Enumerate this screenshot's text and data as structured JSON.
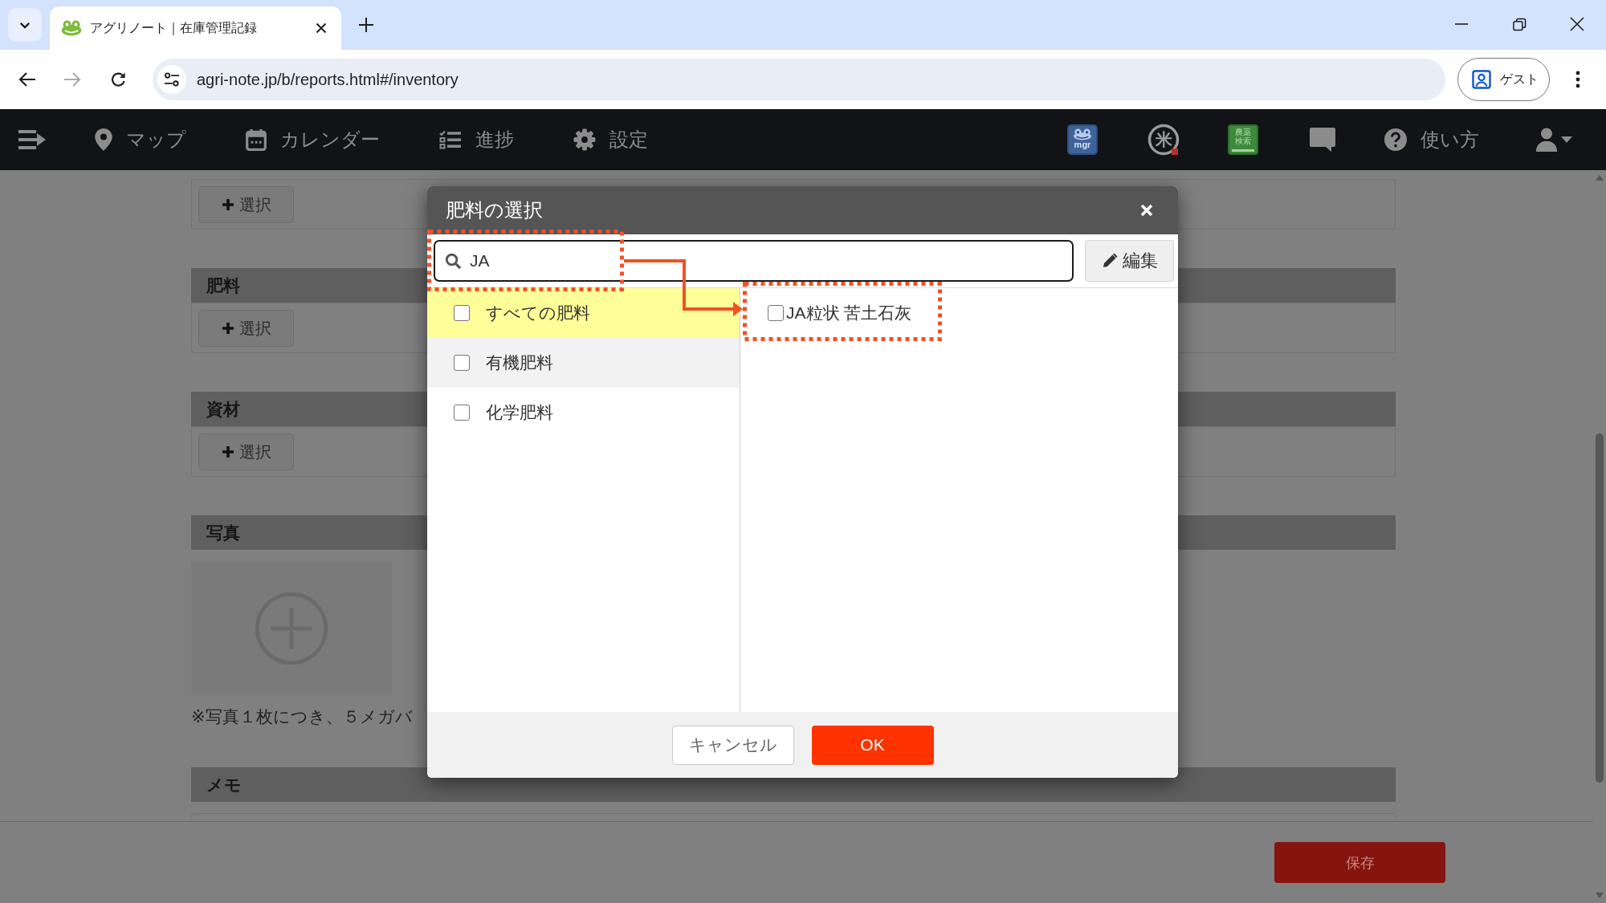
{
  "browser": {
    "tab_title": "アグリノート｜在庫管理記録",
    "forward_disabled": true,
    "url": "agri-note.jp/b/reports.html#/inventory",
    "profile_label": "ゲスト"
  },
  "navbar": {
    "links": [
      {
        "label": "マップ"
      },
      {
        "label": "カレンダー"
      },
      {
        "label": "進捗"
      },
      {
        "label": "設定"
      }
    ],
    "app_badge": "mgr",
    "rice_mark": "米",
    "book_label": "農薬検索",
    "help": "使い方"
  },
  "page": {
    "sections": [
      {
        "kind": "select",
        "button": "選択"
      },
      {
        "kind": "select",
        "title": "肥料",
        "button": "選択"
      },
      {
        "kind": "select",
        "title": "資材",
        "button": "選択"
      },
      {
        "kind": "photo",
        "title": "写真",
        "note": "※写真１枚につき、５メガバ"
      },
      {
        "kind": "memo",
        "title": "メモ"
      }
    ]
  },
  "footer": {
    "save": "保存"
  },
  "modal": {
    "title": "肥料の選択",
    "search": {
      "value": "JA"
    },
    "edit": "編集",
    "categories": [
      {
        "label": "すべての肥料",
        "checked": false,
        "selected": true
      },
      {
        "label": "有機肥料",
        "checked": false,
        "selected": false
      },
      {
        "label": "化学肥料",
        "checked": false,
        "selected": false
      }
    ],
    "results": [
      {
        "label": "JA粒状 苦土石灰",
        "checked": false
      }
    ],
    "buttons": {
      "cancel": "キャンセル",
      "ok": "OK"
    }
  }
}
